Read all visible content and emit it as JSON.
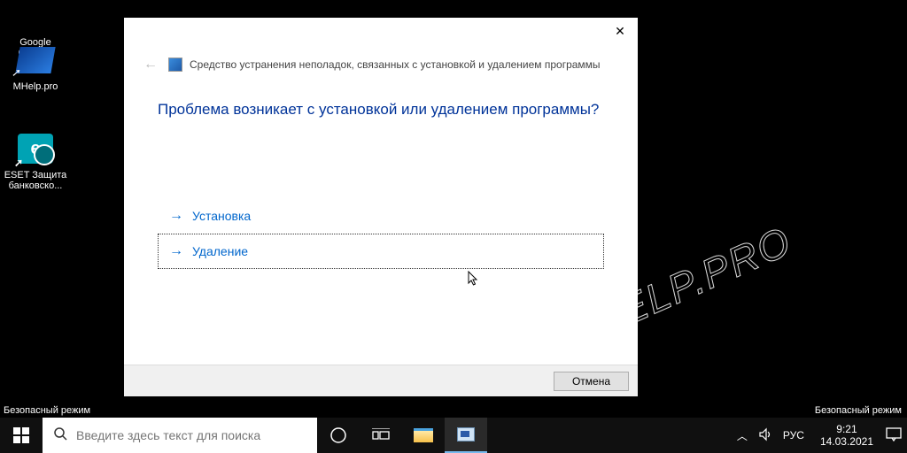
{
  "desktop": {
    "safe_mode_label": "Безопасный режим",
    "icons": [
      {
        "name": "google-chrome",
        "label": "Google\nChrome"
      },
      {
        "name": "mhelp-pro",
        "label": "MHelp.pro"
      },
      {
        "name": "eset-bank-protection",
        "label": "ESET Защита\nбанковско..."
      }
    ]
  },
  "dialog": {
    "title": "Средство устранения неполадок, связанных с установкой и удалением программы",
    "question": "Проблема возникает с установкой или удалением программы?",
    "options": [
      {
        "label": "Установка",
        "selected": false
      },
      {
        "label": "Удаление",
        "selected": true
      }
    ],
    "cancel": "Отмена"
  },
  "taskbar": {
    "search_placeholder": "Введите здесь текст для поиска",
    "lang": "РУС",
    "time": "9:21",
    "date": "14.03.2021"
  },
  "watermark": "MHELP.PRO"
}
